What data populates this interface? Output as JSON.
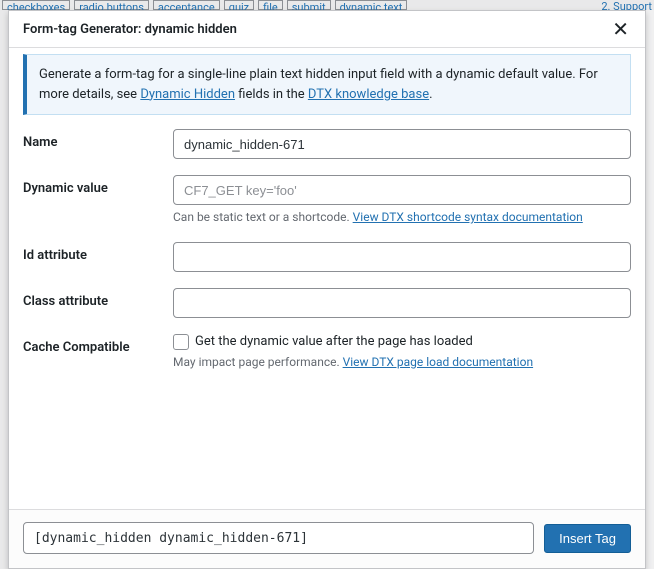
{
  "background": {
    "tabs": [
      "checkboxes",
      "radio buttons",
      "acceptance",
      "quiz",
      "file",
      "submit",
      "dynamic text"
    ],
    "support_link": "2. Support"
  },
  "modal": {
    "title": "Form-tag Generator: dynamic hidden",
    "banner_pre": "Generate a form-tag for a single-line plain text hidden input field with a dynamic default value. For more details, see ",
    "banner_link1": "Dynamic Hidden",
    "banner_mid": " fields in the ",
    "banner_link2": "DTX knowledge base",
    "banner_end": "."
  },
  "fields": {
    "name_label": "Name",
    "name_value": "dynamic_hidden-671",
    "dynvalue_label": "Dynamic value",
    "dynvalue_placeholder": "CF7_GET key='foo'",
    "dynvalue_help_pre": "Can be static text or a shortcode. ",
    "dynvalue_help_link": "View DTX shortcode syntax documentation",
    "id_label": "Id attribute",
    "class_label": "Class attribute",
    "cache_label": "Cache Compatible",
    "cache_checkbox_label": "Get the dynamic value after the page has loaded",
    "cache_help_pre": "May impact page performance. ",
    "cache_help_link": "View DTX page load documentation"
  },
  "footer": {
    "tag_output": "[dynamic_hidden dynamic_hidden-671]",
    "insert_label": "Insert Tag"
  }
}
